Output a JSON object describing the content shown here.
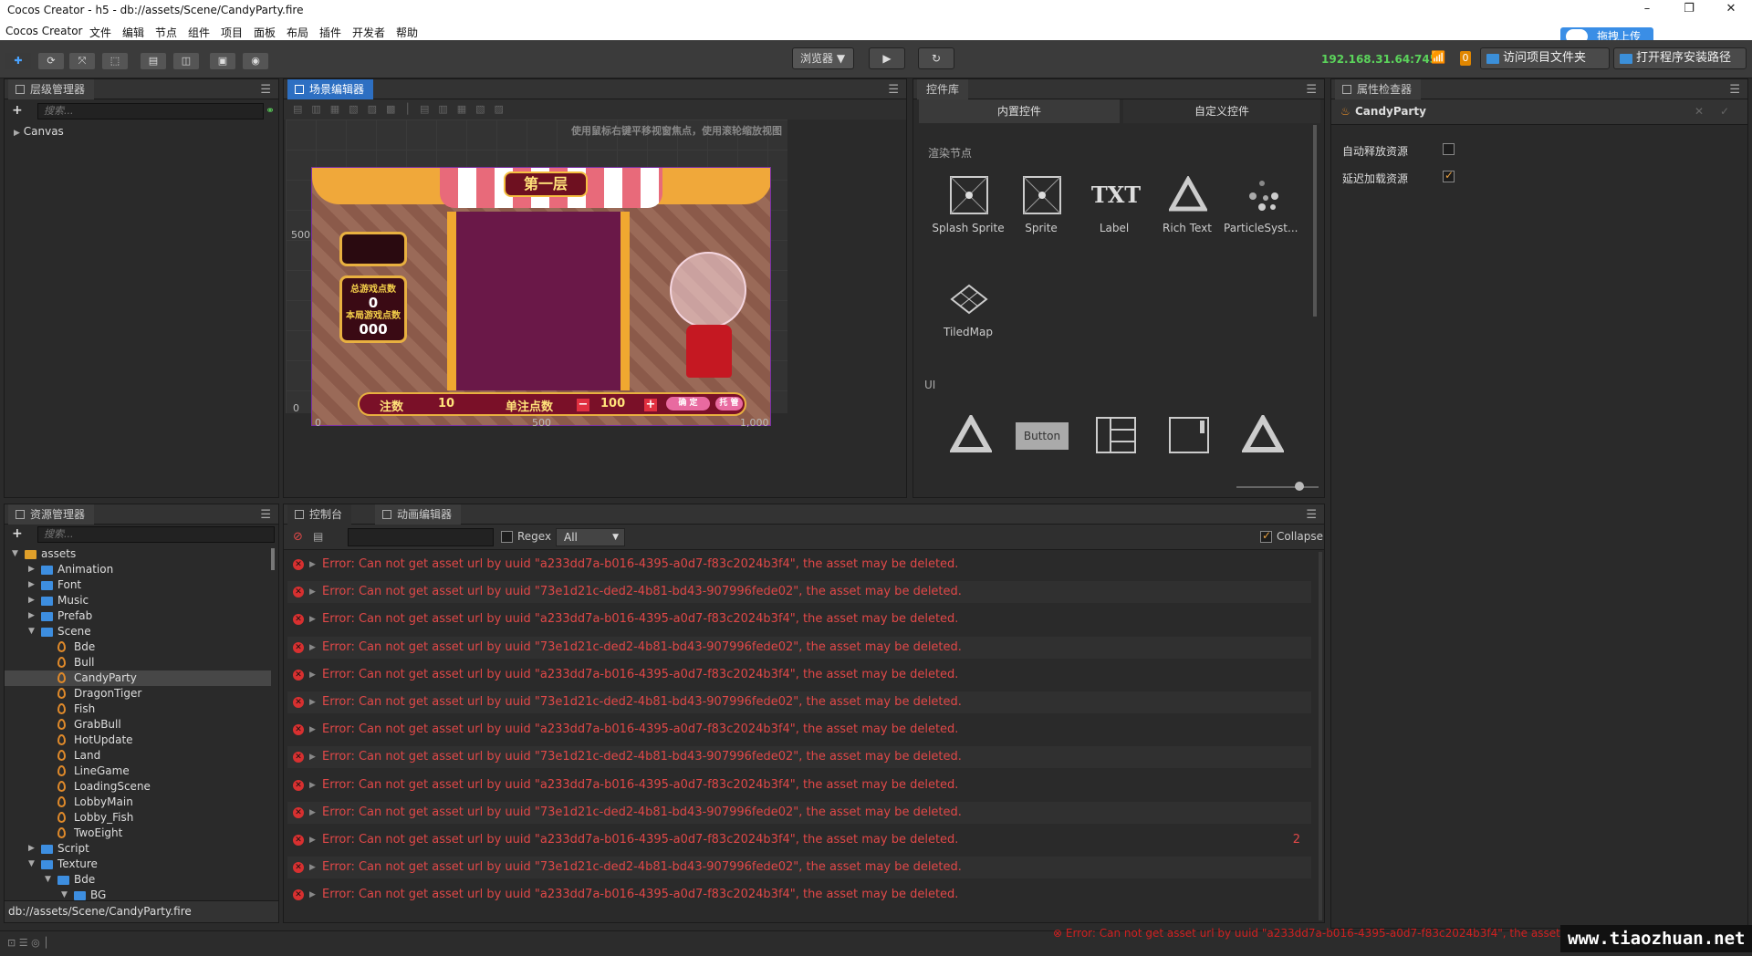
{
  "window": {
    "title": "Cocos Creator - h5 - db://assets/Scene/CandyParty.fire",
    "min": "–",
    "max": "❐",
    "close": "✕"
  },
  "upload_badge": "拖拽上传",
  "menu": [
    "Cocos Creator",
    "文件",
    "编辑",
    "节点",
    "组件",
    "项目",
    "面板",
    "布局",
    "插件",
    "开发者",
    "帮助"
  ],
  "toolbar": {
    "tools": [
      "✚",
      "⟳",
      "⤧",
      "⬚",
      "▤",
      "◫",
      "▣",
      "◉"
    ],
    "browser": "浏览器 ▼",
    "play": "▶",
    "refresh": "↻",
    "ip": "192.168.31.64:7456",
    "wifi": "📶",
    "notify_count": "0",
    "open_project": "访问项目文件夹",
    "open_install": "打开程序安装路径"
  },
  "hierarchy": {
    "tab": "层级管理器",
    "search_placeholder": "搜索...",
    "root": "Canvas"
  },
  "scene": {
    "tab": "场景编辑器",
    "hint": "使用鼠标右键平移视窗焦点，使用滚轮缩放视图",
    "game": {
      "level": "第一层",
      "total_label": "总游戏点数",
      "total_value": "0",
      "round_label": "本局游戏点数",
      "round_value": "000",
      "bet_label": "注数",
      "bet_value": "10",
      "single_label": "单注点数",
      "single_value": "100",
      "minus": "−",
      "plus": "+",
      "confirm": "确 定",
      "auto": "托 管"
    },
    "axis": {
      "y500": "500",
      "y0": "0",
      "x0": "0",
      "x500": "500",
      "x1000": "1,000"
    }
  },
  "widgets": {
    "tab": "控件库",
    "tab_builtin": "内置控件",
    "tab_custom": "自定义控件",
    "section_render": "渲染节点",
    "section_ui": "UI",
    "render_items": [
      {
        "label": "Splash Sprite",
        "icon": "splash-sprite-icon"
      },
      {
        "label": "Sprite",
        "icon": "sprite-icon"
      },
      {
        "label": "Label",
        "icon": "label-icon"
      },
      {
        "label": "Rich Text",
        "icon": "rich-text-icon"
      },
      {
        "label": "ParticleSyst...",
        "icon": "particle-icon"
      },
      {
        "label": "TiledMap",
        "icon": "tiledmap-icon"
      }
    ],
    "ui_button": "Button",
    "txt_glyph": "TXT"
  },
  "inspector": {
    "tab": "属性检查器",
    "node_name": "CandyParty",
    "auto_release": "自动释放资源",
    "auto_release_checked": false,
    "lazy_load": "延迟加载资源",
    "lazy_load_checked": true
  },
  "assets": {
    "tab": "资源管理器",
    "search_placeholder": "搜索...",
    "path": "db://assets/Scene/CandyParty.fire",
    "tree": [
      {
        "label": "assets",
        "depth": 0,
        "type": "root",
        "open": true
      },
      {
        "label": "Animation",
        "depth": 1,
        "type": "folder",
        "open": false
      },
      {
        "label": "Font",
        "depth": 1,
        "type": "folder",
        "open": false
      },
      {
        "label": "Music",
        "depth": 1,
        "type": "folder",
        "open": false
      },
      {
        "label": "Prefab",
        "depth": 1,
        "type": "folder",
        "open": false
      },
      {
        "label": "Scene",
        "depth": 1,
        "type": "folder",
        "open": true
      },
      {
        "label": "Bde",
        "depth": 2,
        "type": "fire"
      },
      {
        "label": "Bull",
        "depth": 2,
        "type": "fire"
      },
      {
        "label": "CandyParty",
        "depth": 2,
        "type": "fire",
        "selected": true
      },
      {
        "label": "DragonTiger",
        "depth": 2,
        "type": "fire"
      },
      {
        "label": "Fish",
        "depth": 2,
        "type": "fire"
      },
      {
        "label": "GrabBull",
        "depth": 2,
        "type": "fire"
      },
      {
        "label": "HotUpdate",
        "depth": 2,
        "type": "fire"
      },
      {
        "label": "Land",
        "depth": 2,
        "type": "fire"
      },
      {
        "label": "LineGame",
        "depth": 2,
        "type": "fire"
      },
      {
        "label": "LoadingScene",
        "depth": 2,
        "type": "fire"
      },
      {
        "label": "LobbyMain",
        "depth": 2,
        "type": "fire"
      },
      {
        "label": "Lobby_Fish",
        "depth": 2,
        "type": "fire"
      },
      {
        "label": "TwoEight",
        "depth": 2,
        "type": "fire"
      },
      {
        "label": "Script",
        "depth": 1,
        "type": "folder",
        "open": false
      },
      {
        "label": "Texture",
        "depth": 1,
        "type": "folder",
        "open": true
      },
      {
        "label": "Bde",
        "depth": 2,
        "type": "folder",
        "open": true
      },
      {
        "label": "BG",
        "depth": 3,
        "type": "folder",
        "open": true
      }
    ]
  },
  "console": {
    "tab": "控制台",
    "tab_anim": "动画编辑器",
    "regex": "Regex",
    "level": "All",
    "collapse": "Collapse",
    "rows": [
      {
        "text": "Error: Can not get asset url by uuid \"a233dd7a-b016-4395-a0d7-f83c2024b3f4\", the asset may be deleted.",
        "count": ""
      },
      {
        "text": "Error: Can not get asset url by uuid \"73e1d21c-ded2-4b81-bd43-907996fede02\", the asset may be deleted.",
        "count": ""
      },
      {
        "text": "Error: Can not get asset url by uuid \"a233dd7a-b016-4395-a0d7-f83c2024b3f4\", the asset may be deleted.",
        "count": ""
      },
      {
        "text": "Error: Can not get asset url by uuid \"73e1d21c-ded2-4b81-bd43-907996fede02\", the asset may be deleted.",
        "count": ""
      },
      {
        "text": "Error: Can not get asset url by uuid \"a233dd7a-b016-4395-a0d7-f83c2024b3f4\", the asset may be deleted.",
        "count": ""
      },
      {
        "text": "Error: Can not get asset url by uuid \"73e1d21c-ded2-4b81-bd43-907996fede02\", the asset may be deleted.",
        "count": ""
      },
      {
        "text": "Error: Can not get asset url by uuid \"a233dd7a-b016-4395-a0d7-f83c2024b3f4\", the asset may be deleted.",
        "count": ""
      },
      {
        "text": "Error: Can not get asset url by uuid \"73e1d21c-ded2-4b81-bd43-907996fede02\", the asset may be deleted.",
        "count": ""
      },
      {
        "text": "Error: Can not get asset url by uuid \"a233dd7a-b016-4395-a0d7-f83c2024b3f4\", the asset may be deleted.",
        "count": ""
      },
      {
        "text": "Error: Can not get asset url by uuid \"73e1d21c-ded2-4b81-bd43-907996fede02\", the asset may be deleted.",
        "count": ""
      },
      {
        "text": "Error: Can not get asset url by uuid \"a233dd7a-b016-4395-a0d7-f83c2024b3f4\", the asset may be deleted.",
        "count": "2"
      },
      {
        "text": "Error: Can not get asset url by uuid \"73e1d21c-ded2-4b81-bd43-907996fede02\", the asset may be deleted.",
        "count": ""
      },
      {
        "text": "Error: Can not get asset url by uuid \"a233dd7a-b016-4395-a0d7-f83c2024b3f4\", the asset may be deleted.",
        "count": ""
      }
    ]
  },
  "status": {
    "error": "⊗ Error: Can not get asset url by uuid \"a233dd7a-b016-4395-a0d7-f83c2024b3f4\", the asset may",
    "watermark": "www.tiaozhuan.net"
  }
}
